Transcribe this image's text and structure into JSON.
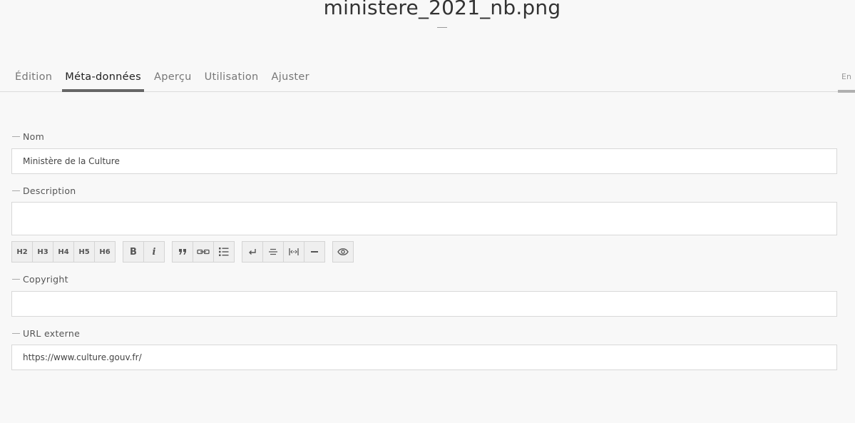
{
  "header": {
    "title": "ministere_2021_nb.png",
    "tabs": [
      {
        "label": "Édition",
        "active": false
      },
      {
        "label": "Méta-données",
        "active": true
      },
      {
        "label": "Aperçu",
        "active": false
      },
      {
        "label": "Utilisation",
        "active": false
      },
      {
        "label": "Ajuster",
        "active": false
      }
    ],
    "language": "En"
  },
  "form": {
    "nom": {
      "label": "Nom",
      "value": "Ministère de la Culture"
    },
    "description": {
      "label": "Description",
      "value": ""
    },
    "copyright": {
      "label": "Copyright",
      "value": ""
    },
    "url_externe": {
      "label": "URL externe",
      "value": "https://www.culture.gouv.fr/"
    }
  },
  "toolbar": {
    "headings": [
      "H2",
      "H3",
      "H4",
      "H5",
      "H6"
    ],
    "bold": "B",
    "italic": "i",
    "icons": [
      "quote-icon",
      "link-icon",
      "bullet-list-icon",
      "line-break-icon",
      "strikethrough-icon",
      "nbsp-icon",
      "horizontal-rule-icon",
      "eye-icon"
    ]
  },
  "colors": {
    "background": "#f8f8f8",
    "active_tab_underline": "#666666",
    "input_border": "#d8d8d8"
  }
}
